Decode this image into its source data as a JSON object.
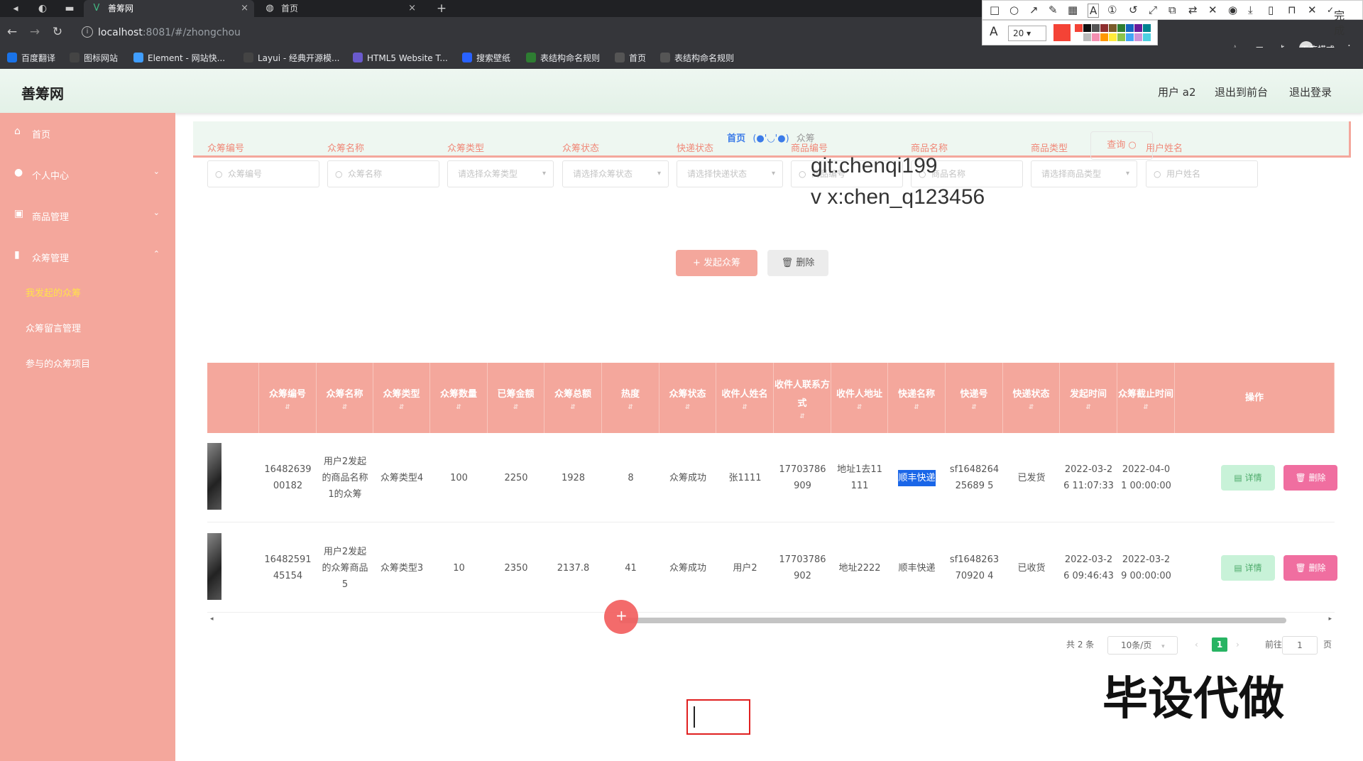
{
  "browser": {
    "tabs": [
      {
        "title": "善筹网",
        "close": "×"
      },
      {
        "title": "首页",
        "close": "×"
      }
    ],
    "new_tab": "+",
    "url": "localhost:8081/#/zhongchou",
    "url_host": "localhost",
    "url_rest": ":8081/#/zhongchou",
    "incognito_label": "无痕模式",
    "bookmarks": [
      {
        "label": "百度翻译",
        "color": "#1a73e8"
      },
      {
        "label": "图标网站",
        "color": "#444"
      },
      {
        "label": "Element - 网站快...",
        "color": "#409eff"
      },
      {
        "label": "Layui - 经典开源模...",
        "color": "#444"
      },
      {
        "label": "HTML5 Website T...",
        "color": "#6a5acd"
      },
      {
        "label": "搜索壁纸",
        "color": "#2962ff"
      },
      {
        "label": "表结构命名规则",
        "color": "#2e7d32"
      },
      {
        "label": "首页",
        "color": "#555"
      },
      {
        "label": "表结构命名规则",
        "color": "#555"
      }
    ],
    "annotation": {
      "size": "20",
      "done": "完成",
      "colors": [
        "#f44336",
        "#111",
        "#555",
        "#8e2f2f",
        "#7a5a2a",
        "#2e7d32",
        "#1565c0",
        "#6a1b9a",
        "#00838f",
        "#fff",
        "#bbb",
        "#f48fb1",
        "#ff9800",
        "#ffeb3b",
        "#8bc34a",
        "#42a5f5",
        "#ce93d8",
        "#4dd0e1"
      ]
    }
  },
  "header": {
    "logo": "善筹网",
    "user": "用户 a2",
    "back": "退出到前台",
    "logout": "退出登录"
  },
  "sidebar": {
    "items": [
      {
        "label": "首页",
        "icon": "home-icon",
        "arrow": ""
      },
      {
        "label": "个人中心",
        "icon": "user-icon",
        "arrow": "⌄"
      },
      {
        "label": "商品管理",
        "icon": "grid-icon",
        "arrow": "⌄"
      },
      {
        "label": "众筹管理",
        "icon": "chart-icon",
        "arrow": "⌃"
      }
    ],
    "subitems": [
      {
        "label": "我发起的众筹",
        "active": true
      },
      {
        "label": "众筹留言管理",
        "active": false
      },
      {
        "label": "参与的众筹项目",
        "active": false
      }
    ]
  },
  "breadcrumb": {
    "home": "首页",
    "face": "(●'◡'●)",
    "current": "众筹"
  },
  "filters": [
    {
      "label": "众筹编号",
      "placeholder": "众筹编号",
      "type": "input"
    },
    {
      "label": "众筹名称",
      "placeholder": "众筹名称",
      "type": "input"
    },
    {
      "label": "众筹类型",
      "placeholder": "请选择众筹类型",
      "type": "select"
    },
    {
      "label": "众筹状态",
      "placeholder": "请选择众筹状态",
      "type": "select"
    },
    {
      "label": "快递状态",
      "placeholder": "请选择快递状态",
      "type": "select"
    },
    {
      "label": "商品编号",
      "placeholder": "商品编号",
      "type": "input"
    },
    {
      "label": "商品名称",
      "placeholder": "商品名称",
      "type": "input"
    },
    {
      "label": "商品类型",
      "placeholder": "请选择商品类型",
      "type": "select"
    },
    {
      "label": "用户姓名",
      "placeholder": "用户姓名",
      "type": "input"
    }
  ],
  "actions": {
    "query": "查询",
    "add": "+ 发起众筹",
    "delete": "删除"
  },
  "watermark": {
    "line1": "git:chenqi199",
    "line2": "v x:chen_q123456",
    "big": "毕设代做"
  },
  "table": {
    "columns": [
      "众筹编号",
      "众筹名称",
      "众筹类型",
      "众筹数量",
      "已筹金额",
      "众筹总额",
      "热度",
      "众筹状态",
      "收件人姓名",
      "收件人联系方式",
      "收件人地址",
      "快递名称",
      "快递号",
      "快递状态",
      "发起时间",
      "众筹截止时间",
      "操作"
    ],
    "rows": [
      [
        "1648263900182",
        "用户2发起的商品名称1的众筹",
        "众筹类型4",
        "100",
        "2250",
        "1928",
        "8",
        "众筹成功",
        "张1111",
        "17703786909",
        "地址1去11111",
        "顺丰快递",
        "sf164826425689 5",
        "已发货",
        "2022-03-26 11:07:33",
        "2022-04-01 00:00:00"
      ],
      [
        "1648259145154",
        "用户2发起的众筹商品5",
        "众筹类型3",
        "10",
        "2350",
        "2137.8",
        "41",
        "众筹成功",
        "用户2",
        "17703786902",
        "地址2222",
        "顺丰快递",
        "sf164826370920 4",
        "已收货",
        "2022-03-26 09:46:43",
        "2022-03-29 00:00:00"
      ]
    ],
    "detail_label": "详情",
    "delete_label": "删除"
  },
  "pager": {
    "total": "共 2 条",
    "size": "10条/页",
    "current": "1",
    "goto": "前往",
    "page_input": "1",
    "page_unit": "页"
  }
}
